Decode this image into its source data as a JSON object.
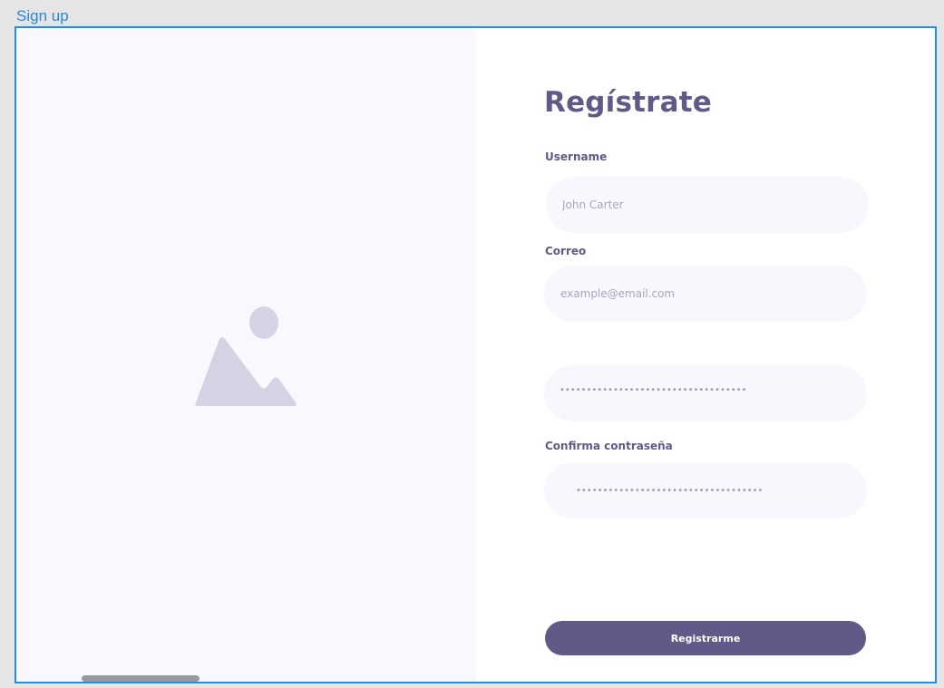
{
  "frame": {
    "label": "Sign up"
  },
  "form": {
    "title": "Regístrate",
    "username": {
      "label": "Username",
      "placeholder": "John Carter"
    },
    "email": {
      "label": "Correo",
      "placeholder": "example@email.com"
    },
    "password": {
      "label": "",
      "mask": "•••••••••••••••••••••••••••••••••••"
    },
    "confirm_password": {
      "label": "Confirma contraseña",
      "mask": "•••••••••••••••••••••••••••••••••••"
    },
    "submit_label": "Registrarme"
  },
  "colors": {
    "accent": "#5f5a88",
    "frame_border": "#1e8fe6",
    "input_bg": "#f8f7fe",
    "left_panel_bg": "#f9f8fe",
    "image_placeholder": "#d5d3e3"
  },
  "icons": {
    "hero": "image-placeholder-icon"
  }
}
